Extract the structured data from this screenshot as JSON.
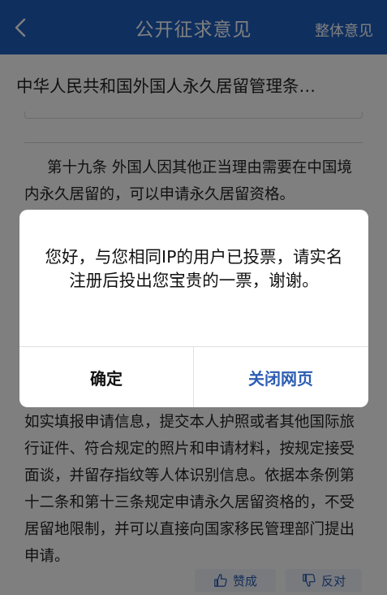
{
  "navbar": {
    "title": "公开征求意见",
    "action": "整体意见"
  },
  "document": {
    "title": "中华人民共和国外国人永久居留管理条…",
    "article_top": "第十九条  外国人因其他正当理由需要在中国境内永久居留的，可以申请永久居留资格。",
    "article_bottom": "如实填报申请信息，提交本人护照或者其他国际旅行证件、符合规定的照片和申请材料，按规定接受面谈，并留存指纹等人体识别信息。依据本条例第十二条和第十三条规定申请永久居留资格的，不受居留地限制，并可以直接向国家移民管理部门提出申请。"
  },
  "vote": {
    "approve_label": "赞成",
    "oppose_label": "反对"
  },
  "dialog": {
    "message": "您好，与您相同IP的用户已投票，请实名注册后投出您宝贵的一票，谢谢。",
    "confirm_label": "确定",
    "close_label": "关闭网页"
  },
  "icons": {
    "back": "chevron-left-icon",
    "approve": "thumbs-up-icon",
    "oppose": "thumbs-down-icon"
  },
  "colors": {
    "navbar": "#1f5fbf",
    "accent": "#2c5db3"
  }
}
